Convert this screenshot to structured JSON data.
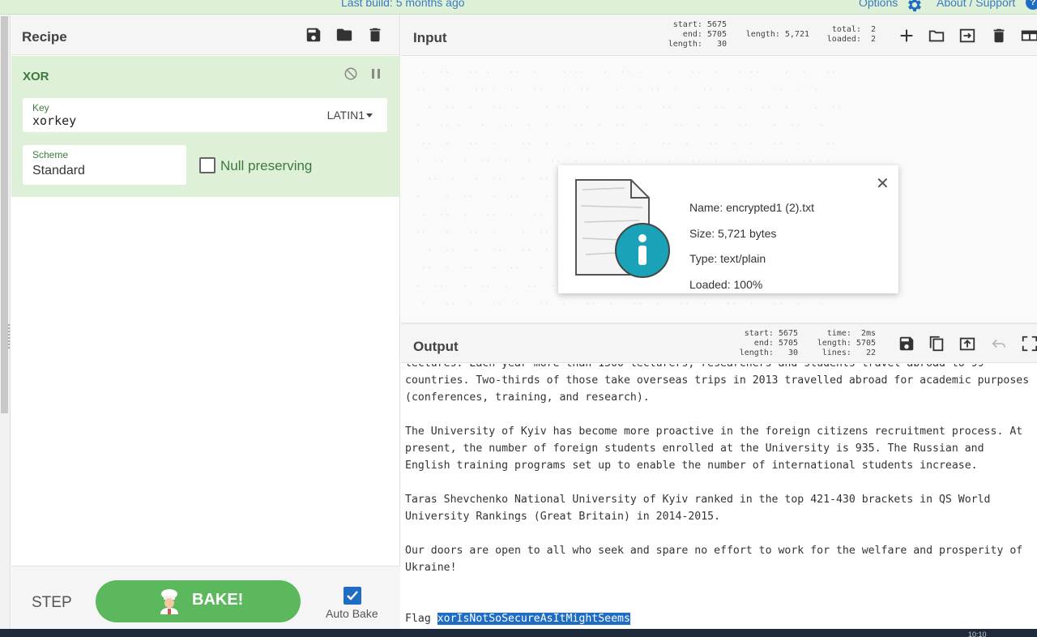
{
  "banner": {
    "build": "Last build: 5 months ago",
    "options": "Options",
    "about": "About / Support",
    "help": "?"
  },
  "recipe": {
    "title": "Recipe",
    "operation": {
      "name": "XOR",
      "key_label": "Key",
      "key_value": "xorkey",
      "key_encoding": "LATIN1",
      "scheme_label": "Scheme",
      "scheme_value": "Standard",
      "null_preserving_label": "Null preserving",
      "null_preserving_checked": false
    },
    "step_label": "STEP",
    "bake_label": "BAKE!",
    "auto_bake_label": "Auto Bake",
    "auto_bake_checked": true
  },
  "input": {
    "title": "Input",
    "stats_left": "start: 5675\n  end: 5705\nlength:   30",
    "stats_length": "length: 5,721",
    "stats_right": "total:  2\nloaded:  2",
    "file": {
      "name": "Name: encrypted1 (2).txt",
      "size": "Size: 5,721 bytes",
      "type": "Type: text/plain",
      "loaded": "Loaded: 100%"
    }
  },
  "output": {
    "title": "Output",
    "stats_left": "start: 5675\n  end: 5705\nlength:   30",
    "stats_right": " time:  2ms\nlength: 5705\n lines:   22",
    "lines": [
      "lectures. Each year more than 1500 lecturers, researchers and students travel abroad to 99",
      "countries. Two-thirds of those take overseas trips in 2013 travelled abroad for academic purposes",
      "(conferences, training, and research).",
      "",
      "The University of Kyiv has become more proactive in the foreign citizens recruitment process. At",
      "present, the number of foreign students enrolled at the University is 935. The Russian and",
      "English training programs set up to enable the number of international students increase.",
      "",
      "Taras Shevchenko National University of Kyiv ranked in the top 421-430 brackets in QS World",
      "University Rankings (Great Britain) in 2014-2015.",
      "",
      "Our doors are open to all who seek and spare no effort to work for the welfare and prosperity of",
      "Ukraine!",
      "",
      ""
    ],
    "flag_prefix": "Flag ",
    "flag_value": "xorIsNotSoSecureAsItMightSeems"
  },
  "taskbar": {
    "clock": "10:10"
  },
  "colors": {
    "accent_green": "#5cb85c",
    "op_background": "#dff0d8",
    "selection_blue": "#1f6dc2"
  }
}
